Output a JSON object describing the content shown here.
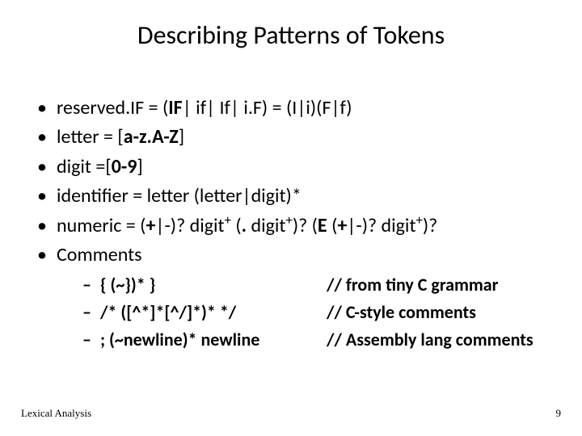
{
  "title": "Describing Patterns of Tokens",
  "bullets": {
    "b1a": "reserved.IF = (",
    "b1b": "IF",
    "b1c": "| if| If| i.F)    = (I|i)(F|f)",
    "b2a": "letter = [",
    "b2b": "a-z.A-Z",
    "b2c": "]",
    "b3a": "digit =[",
    "b3b": "0-9",
    "b3c": "]",
    "b4": "identifier = letter (letter|digit)*",
    "b5a": "numeric = (",
    "b5b": "+",
    "b5c": "|-)? digit",
    "b5d": " (",
    "b5e": ".",
    "b5f": " digit",
    "b5g": ")? (",
    "b5h": "E",
    "b5i": " (",
    "b5j": "+",
    "b5k": "|-)? digit",
    "b5l": ")?",
    "b6": "Comments"
  },
  "sup": "+",
  "sub": {
    "s1l": "{ (~})* }",
    "s1r": "// from tiny C grammar",
    "s2l": "/* ([^*]*[^/]*)* */",
    "s2r": "// C-style comments",
    "s3l": "; (~newline)* newline",
    "s3r": "// Assembly lang comments"
  },
  "footer": {
    "left": "Lexical Analysis",
    "right": "9"
  }
}
